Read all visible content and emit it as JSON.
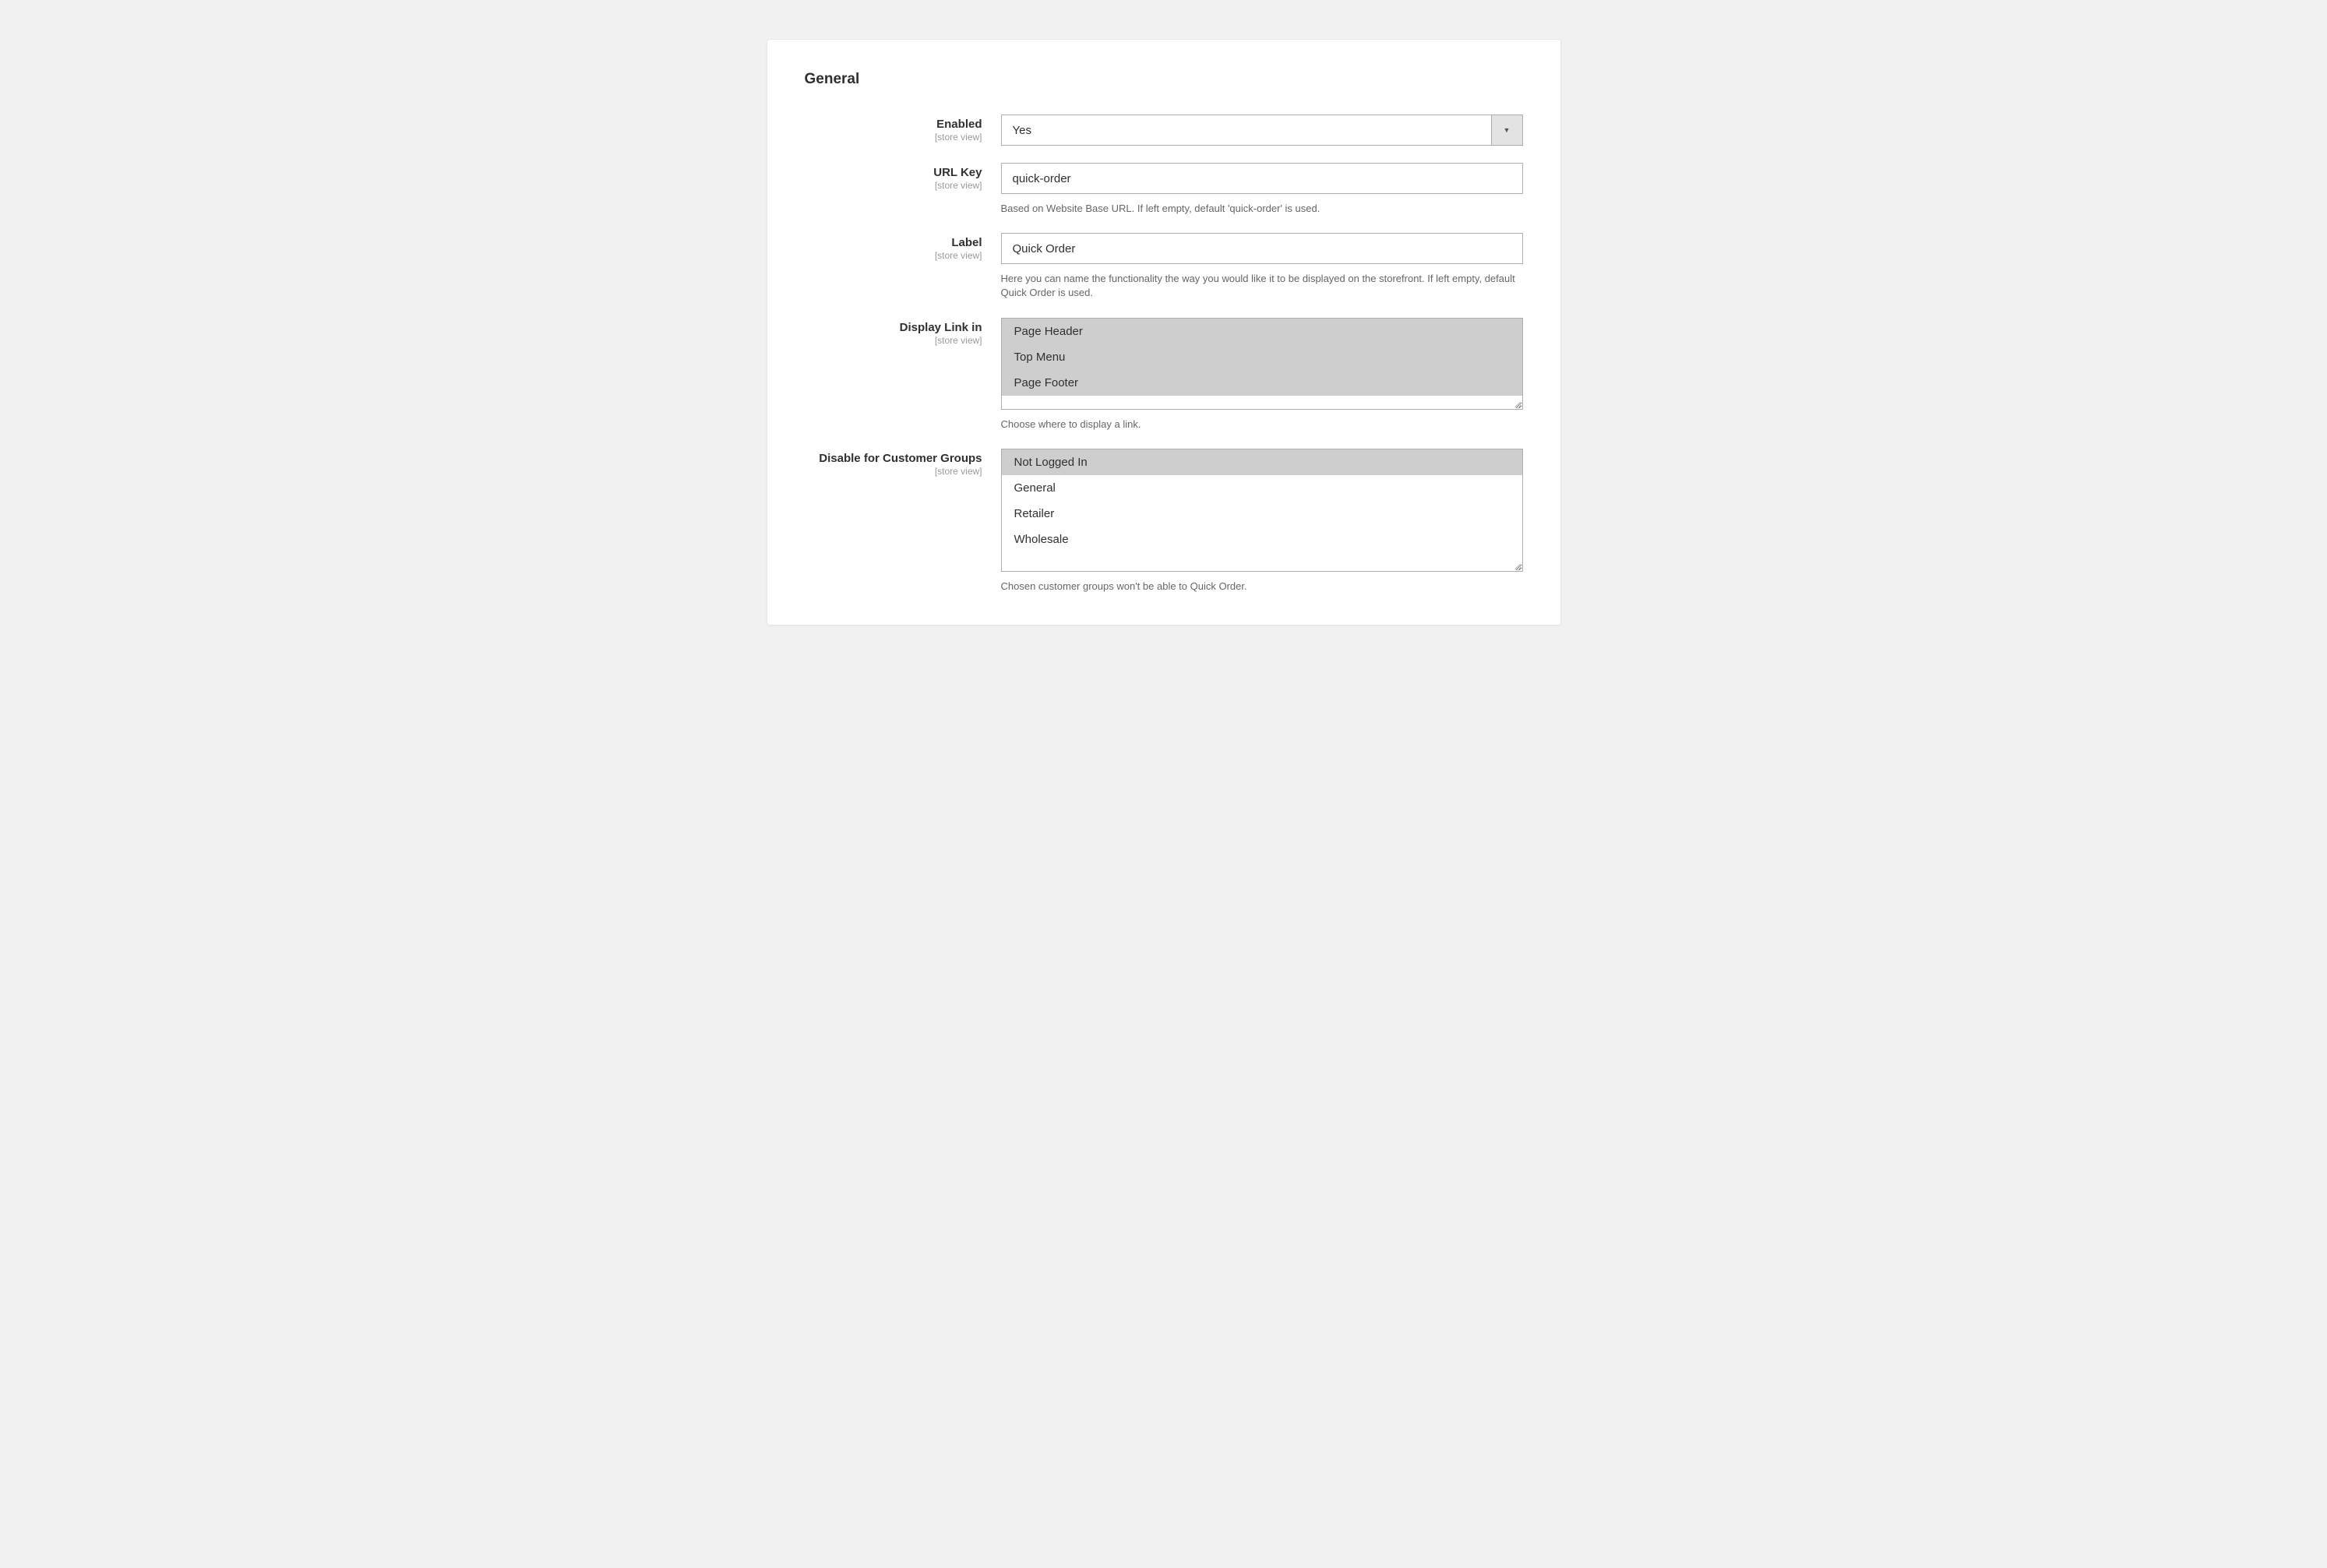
{
  "section": {
    "title": "General"
  },
  "scope_label": "[store view]",
  "fields": {
    "enabled": {
      "label": "Enabled",
      "value": "Yes"
    },
    "url_key": {
      "label": "URL Key",
      "value": "quick-order",
      "note": "Based on Website Base URL. If left empty, default 'quick-order' is used."
    },
    "label_field": {
      "label": "Label",
      "value": "Quick Order",
      "note": "Here you can name the functionality the way you would like it to be displayed on the storefront. If left empty, default Quick Order is used."
    },
    "display_link_in": {
      "label": "Display Link in",
      "options": [
        "Page Header",
        "Top Menu",
        "Page Footer"
      ],
      "selected_indexes": [
        0,
        1,
        2
      ],
      "note": "Choose where to display a link."
    },
    "disable_for_groups": {
      "label": "Disable for Customer Groups",
      "options": [
        "Not Logged In",
        "General",
        "Retailer",
        "Wholesale"
      ],
      "selected_indexes": [
        0
      ],
      "note": "Chosen customer groups won't be able to Quick Order."
    }
  }
}
